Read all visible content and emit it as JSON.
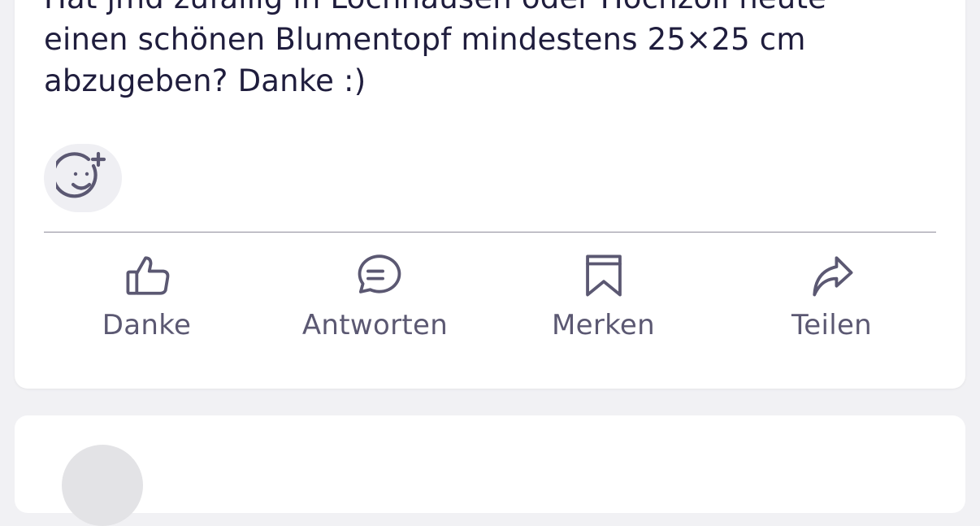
{
  "post": {
    "text": "Hat jmd zufällig in Lochhausen oder Hochzoll heute\neinen schönen Blumentopf mindestens 25×25 cm\nabzugeben? Danke :)"
  },
  "reaction_button": {
    "icon": "add-reaction-icon"
  },
  "actions": [
    {
      "label": "Danke",
      "icon": "thumbs-up-icon"
    },
    {
      "label": "Antworten",
      "icon": "comment-icon"
    },
    {
      "label": "Merken",
      "icon": "bookmark-icon"
    },
    {
      "label": "Teilen",
      "icon": "share-icon"
    }
  ],
  "colors": {
    "background": "#f1f1f4",
    "card": "#ffffff",
    "text": "#1f1d3d",
    "icon": "#5b5872",
    "divider": "#8e8c9a"
  }
}
